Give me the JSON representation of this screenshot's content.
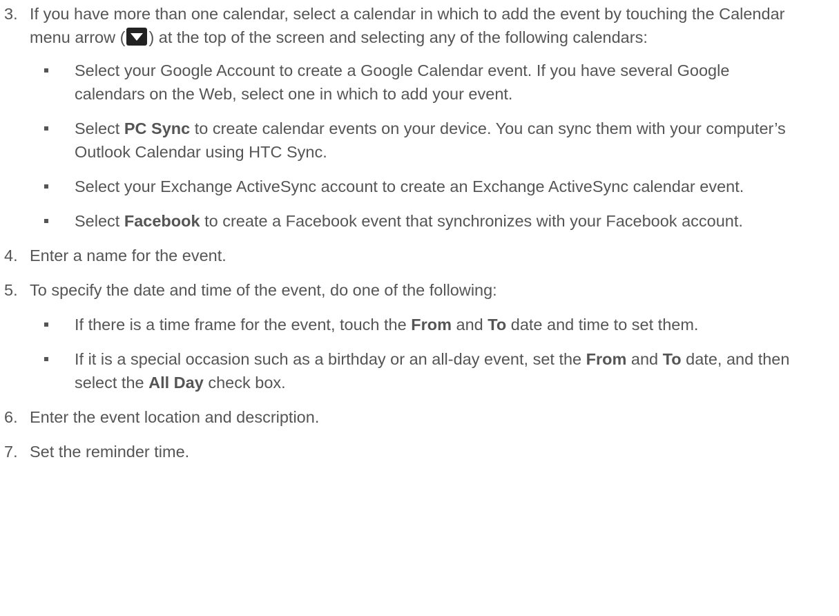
{
  "steps": [
    {
      "number": "3.",
      "text_before_icon": "If you have more than one calendar, select a calendar in which to add the event by touching the Calendar menu arrow (",
      "text_after_icon": ") at the top of the screen and selecting any of the following calendars:",
      "icon": "calendar-menu-arrow-icon",
      "subitems": [
        {
          "parts": [
            {
              "t": "Select your Google Account to create a Google Calendar event. If you have several Google calendars on the Web, select one in which to add your event.",
              "b": false
            }
          ]
        },
        {
          "parts": [
            {
              "t": "Select ",
              "b": false
            },
            {
              "t": "PC Sync",
              "b": true
            },
            {
              "t": " to create calendar events on your device. You can sync them with your computer’s Outlook Calendar using HTC Sync.",
              "b": false
            }
          ]
        },
        {
          "parts": [
            {
              "t": "Select your Exchange ActiveSync account to create an Exchange ActiveSync calendar event.",
              "b": false
            }
          ]
        },
        {
          "parts": [
            {
              "t": "Select ",
              "b": false
            },
            {
              "t": "Facebook",
              "b": true
            },
            {
              "t": " to create a Facebook event that synchronizes with your Facebook account.",
              "b": false
            }
          ]
        }
      ]
    },
    {
      "number": "4.",
      "text": "Enter a name for the event."
    },
    {
      "number": "5.",
      "text": "To specify the date and time of the event, do one of the following:",
      "subitems": [
        {
          "parts": [
            {
              "t": "If there is a time frame for the event, touch the ",
              "b": false
            },
            {
              "t": "From",
              "b": true
            },
            {
              "t": " and ",
              "b": false
            },
            {
              "t": "To",
              "b": true
            },
            {
              "t": " date and time to set them.",
              "b": false
            }
          ]
        },
        {
          "parts": [
            {
              "t": "If it is a special occasion such as a birthday or an all-day event, set the ",
              "b": false
            },
            {
              "t": "From",
              "b": true
            },
            {
              "t": " and ",
              "b": false
            },
            {
              "t": "To",
              "b": true
            },
            {
              "t": " date, and then select the ",
              "b": false
            },
            {
              "t": "All Day",
              "b": true
            },
            {
              "t": " check box.",
              "b": false
            }
          ]
        }
      ]
    },
    {
      "number": "6.",
      "text": "Enter the event location and description."
    },
    {
      "number": "7.",
      "text": "Set the reminder time."
    }
  ],
  "colors": {
    "text": "#555555",
    "icon_background": "#222222",
    "icon_arrow": "#ffffff"
  }
}
